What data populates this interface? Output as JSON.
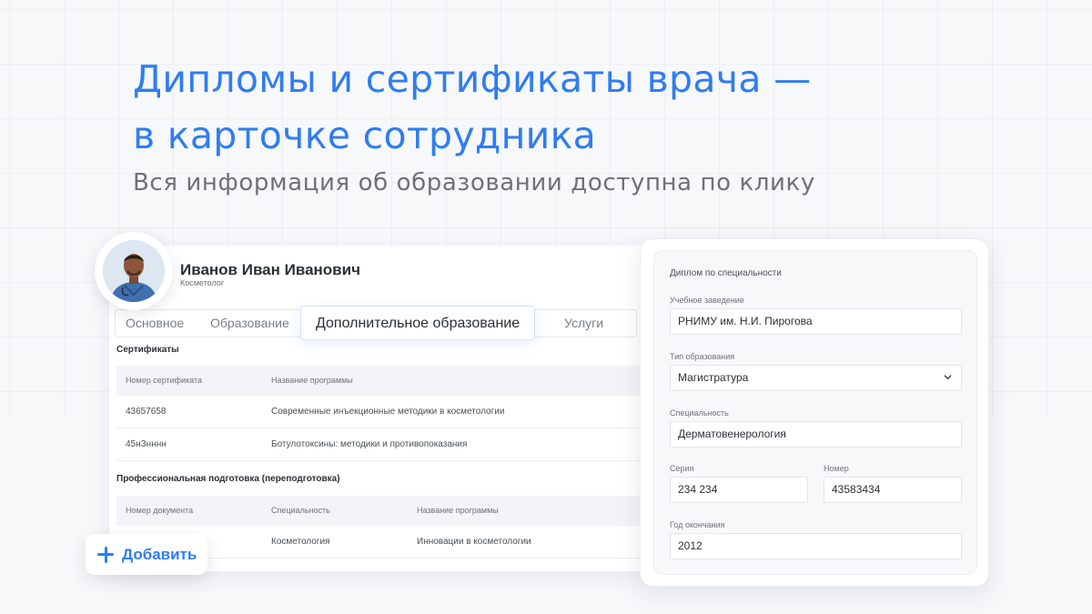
{
  "headline": {
    "line1": "Дипломы и сертификаты врача —",
    "line2": "в карточке сотрудника"
  },
  "subtitle": "Вся информация об образовании доступна по клику",
  "employee": {
    "name": "Иванов Иван Иванович",
    "role": "Косметолог"
  },
  "tabs": {
    "main": "Основное",
    "education": "Образование",
    "additional": "Дополнительное образование",
    "services": "Услуги"
  },
  "certificates": {
    "title": "Сертификаты",
    "headers": [
      "Номер  сертификата",
      "Название программы"
    ],
    "rows": [
      [
        "43657658",
        "Современные инъекционные методики в косметологии"
      ],
      [
        "45нЗнннн",
        "Ботулотоксины: методики и противопоказания"
      ]
    ]
  },
  "retraining": {
    "title": "Профессиональная подготовка (переподготовка)",
    "headers": [
      "Номер  документа",
      "Специальность",
      "Название программы"
    ],
    "rows": [
      [
        "",
        "Косметология",
        "Инновации в косметологии"
      ]
    ]
  },
  "add_button": "Добавить",
  "diploma": {
    "title": "Диплом по специальности",
    "institution_label": "Учебное заведение",
    "institution": "РНИМУ им. Н.И. Пирогова",
    "type_label": "Тип образования",
    "type": "Магистратура",
    "specialty_label": "Специальность",
    "specialty": "Дерматовенерология",
    "series_label": "Серия",
    "series": "234 234",
    "number_label": "Номер",
    "number": "43583434",
    "year_label": "Год окончания",
    "year": "2012"
  },
  "colors": {
    "accent": "#2f7df0",
    "text": "#2b2f36",
    "muted": "#6d7178"
  }
}
